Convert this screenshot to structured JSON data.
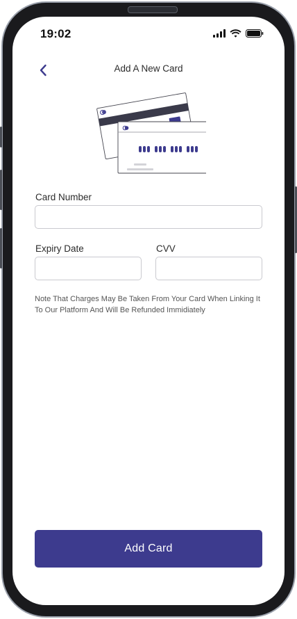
{
  "status_bar": {
    "time": "19:02",
    "icons": [
      "signal-bars-icon",
      "wifi-icon",
      "battery-icon"
    ]
  },
  "header": {
    "back_icon": "chevron-left-icon",
    "title": "Add A New Card"
  },
  "illustration": {
    "name": "credit-cards-illustration",
    "masked_number": "•••• •••• •••• ••••"
  },
  "form": {
    "card_number_label": "Card Number",
    "card_number_value": "",
    "expiry_label": "Expiry Date",
    "expiry_value": "",
    "cvv_label": "CVV",
    "cvv_value": ""
  },
  "note": "Note That Charges May Be Taken From Your Card When Linking It To Our Platform And Will Be Refunded Immidiately",
  "submit": {
    "label": "Add Card"
  },
  "colors": {
    "accent": "#3d3b8e",
    "card_stripe": "#3a3a4a",
    "input_border": "#c9c9cf",
    "text": "#2b2b2b"
  }
}
